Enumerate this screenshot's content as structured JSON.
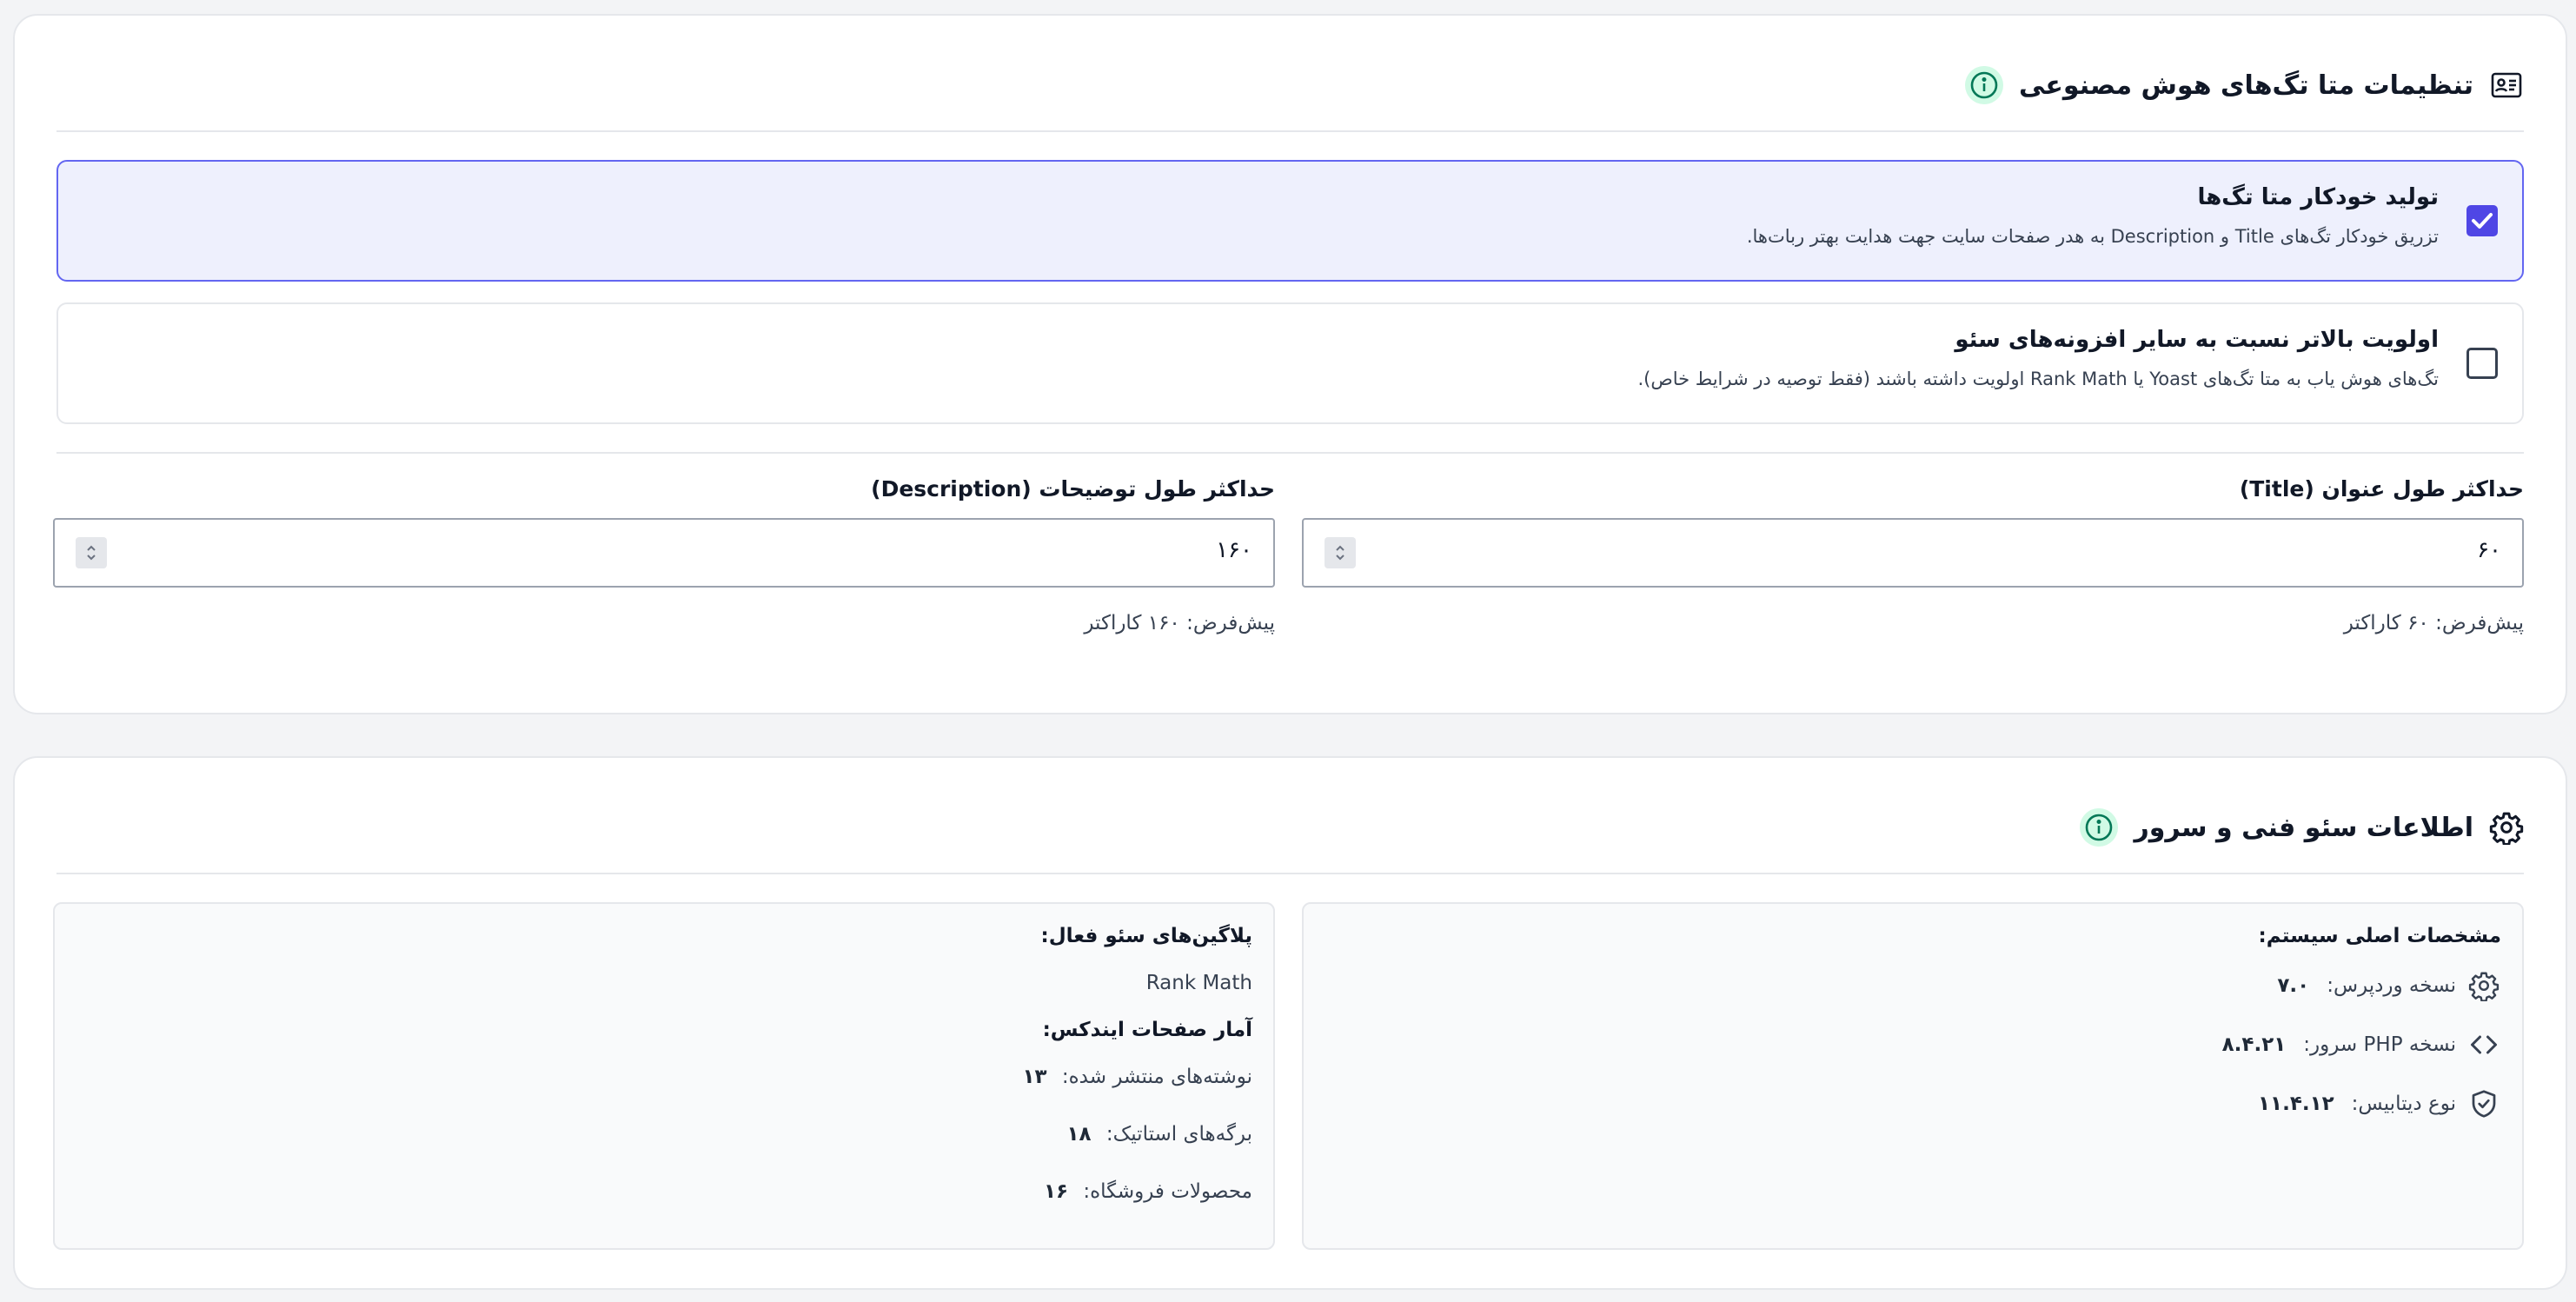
{
  "meta_settings": {
    "title": "تنظیمات متا تگ‌های هوش مصنوعی",
    "header_icon": "id-card-icon",
    "info_icon": "info-icon",
    "auto_generate": {
      "title": "تولید خودکار متا تگ‌ها",
      "description": "تزریق خودکار تگ‌های Title و Description به هدر صفحات سایت جهت هدایت بهتر ربات‌ها.",
      "checked": true
    },
    "priority": {
      "title": "اولویت بالاتر نسبت به سایر افزونه‌های سئو",
      "description": "تگ‌های هوش یاب به متا تگ‌های Yoast یا Rank Math اولویت داشته باشند (فقط توصیه در شرایط خاص).",
      "checked": false
    },
    "title_length": {
      "label": "حداکثر طول عنوان (Title)",
      "value": "۶۰",
      "help": "پیش‌فرض: ۶۰ کاراکتر"
    },
    "description_length": {
      "label": "حداکثر طول توضیحات (Description)",
      "value": "۱۶۰",
      "help": "پیش‌فرض: ۱۶۰ کاراکتر"
    }
  },
  "tech_seo": {
    "title": "اطلاعات سئو فنی و سرور",
    "header_icon": "gear-icon",
    "info_icon": "info-icon",
    "system": {
      "heading": "مشخصات اصلی سیستم:",
      "rows": [
        {
          "icon": "gear-icon",
          "label": "نسخه وردپرس:",
          "value": "۷.۰"
        },
        {
          "icon": "code-icon",
          "label": "نسخه PHP سرور:",
          "value": "۸.۴.۲۱"
        },
        {
          "icon": "shield-icon",
          "label": "نوع دیتابیس:",
          "value": "۱۱.۴.۱۲"
        }
      ]
    },
    "plugins": {
      "heading": "پلاگین‌های سئو فعال:",
      "active": "Rank Math",
      "stats_heading": "آمار صفحات ایندکس:",
      "stats": [
        {
          "label": "نوشته‌های منتشر شده:",
          "value": "۱۳"
        },
        {
          "label": "برگه‌های استاتیک:",
          "value": "۱۸"
        },
        {
          "label": "محصولات فروشگاه:",
          "value": "۱۶"
        }
      ]
    }
  },
  "colors": {
    "accent": "#4f46e5",
    "accent_bg": "#eef0fd",
    "info_green": "#047857"
  }
}
